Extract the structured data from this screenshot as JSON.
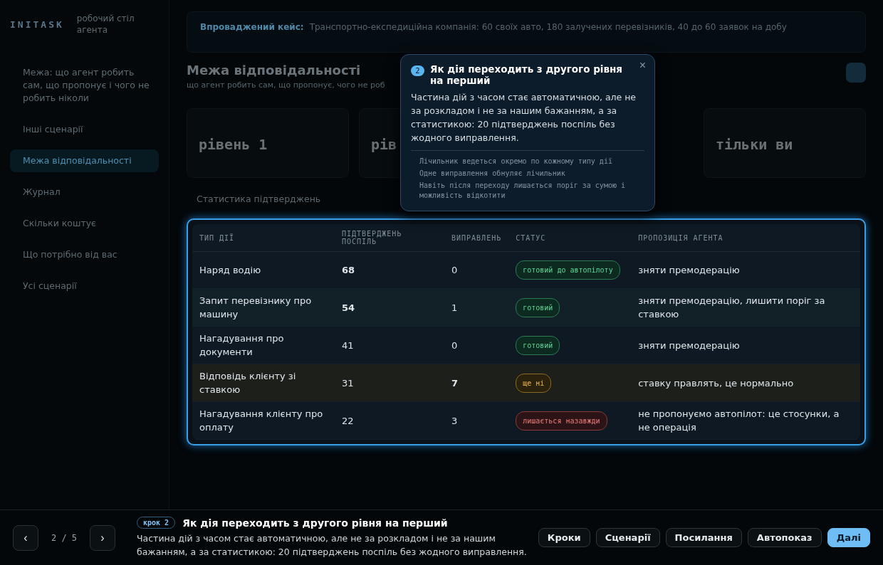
{
  "sidebar": {
    "logo": "INITASK",
    "subtitle": "робочий стіл агента",
    "items": [
      {
        "label": "Межа: що агент робить сам, що пропонує і чого не робить ніколи",
        "selected": false
      },
      {
        "label": "Інші сценарії",
        "selected": false
      },
      {
        "label": "Межа відповідальності",
        "selected": true
      },
      {
        "label": "Журнал",
        "selected": false
      },
      {
        "label": "Скільки коштує",
        "selected": false
      },
      {
        "label": "Що потрібно від вас",
        "selected": false
      },
      {
        "label": "Усі сценарії",
        "selected": false
      }
    ]
  },
  "banner": {
    "label": "Впроваджений кейс:",
    "text": "Транспортно-експедиційна компанія: 60 своїх авто, 180 залучених перевізників, 40 до 60 заявок на добу"
  },
  "header": {
    "title": "Межа відповідальності",
    "subtitle": "що агент робить сам, що пропонує, чого не роб"
  },
  "cards": [
    {
      "value": "рівень 1"
    },
    {
      "value": "рів"
    },
    {
      "value": "тільки ви"
    }
  ],
  "stats_title": "Статистика підтверджень",
  "table": {
    "columns": [
      "ТИП ДІЇ",
      "ПІДТВЕРДЖЕНЬ ПОСПІЛЬ",
      "ВИПРАВЛЕНЬ",
      "СТАТУС",
      "ПРОПОЗИЦІЯ АГЕНТА"
    ],
    "rows": [
      {
        "action": "Наряд водію",
        "confirmations": "68",
        "confirmations_strong": true,
        "corrections": "0",
        "corrections_strong": false,
        "status": "готовий до автопілоту",
        "kind": "ready",
        "proposal": "зняти премодерацію"
      },
      {
        "action": "Запит перевізнику про машину",
        "confirmations": "54",
        "confirmations_strong": true,
        "corrections": "1",
        "corrections_strong": false,
        "status": "готовий",
        "kind": "ready",
        "proposal": "зняти премодерацію, лишити поріг за ставкою"
      },
      {
        "action": "Нагадування про документи",
        "confirmations": "41",
        "confirmations_strong": false,
        "corrections": "0",
        "corrections_strong": false,
        "status": "готовий",
        "kind": "ready",
        "proposal": "зняти премодерацію"
      },
      {
        "action": "Відповідь клієнту зі ставкою",
        "confirmations": "31",
        "confirmations_strong": false,
        "corrections": "7",
        "corrections_strong": true,
        "status": "ще ні",
        "kind": "pending",
        "proposal": "ставку правлять, це нормально"
      },
      {
        "action": "Нагадування клієнту про оплату",
        "confirmations": "22",
        "confirmations_strong": false,
        "corrections": "3",
        "corrections_strong": false,
        "status": "лишається назавжди",
        "kind": "forever",
        "proposal": "не пропонуємо автопілот: це стосунки, а не операція"
      }
    ]
  },
  "tooltip": {
    "step": "2",
    "title": "Як дія переходить з другого рівня на перший",
    "close": "×",
    "body": "Частина дій з часом стає автоматичною, але не за розкладом і не за нашим бажанням, а за статистикою: 20 підтверджень поспіль без жодного виправлення.",
    "bullets": [
      "Лічильник ведеться окремо по кожному типу дії",
      "Одне виправлення обнуляє лічильник",
      "Навіть після переходу лишається поріг за сумою і можливість відкотити"
    ]
  },
  "tour_bar": {
    "prev": "‹",
    "counter": "2 / 5",
    "next": "›",
    "step_tag": "крок 2",
    "title": "Як дія переходить з другого рівня на перший",
    "text": "Частина дій з часом стає автоматичною, але не за розкладом і не за нашим бажанням, а за статистикою: 20 підтверджень поспіль без жодного виправлення.",
    "buttons": [
      {
        "label": "Кроки",
        "primary": false
      },
      {
        "label": "Сценарії",
        "primary": false
      },
      {
        "label": "Посилання",
        "primary": false
      },
      {
        "label": "Автопоказ",
        "primary": false
      },
      {
        "label": "Далі",
        "primary": true
      }
    ]
  }
}
